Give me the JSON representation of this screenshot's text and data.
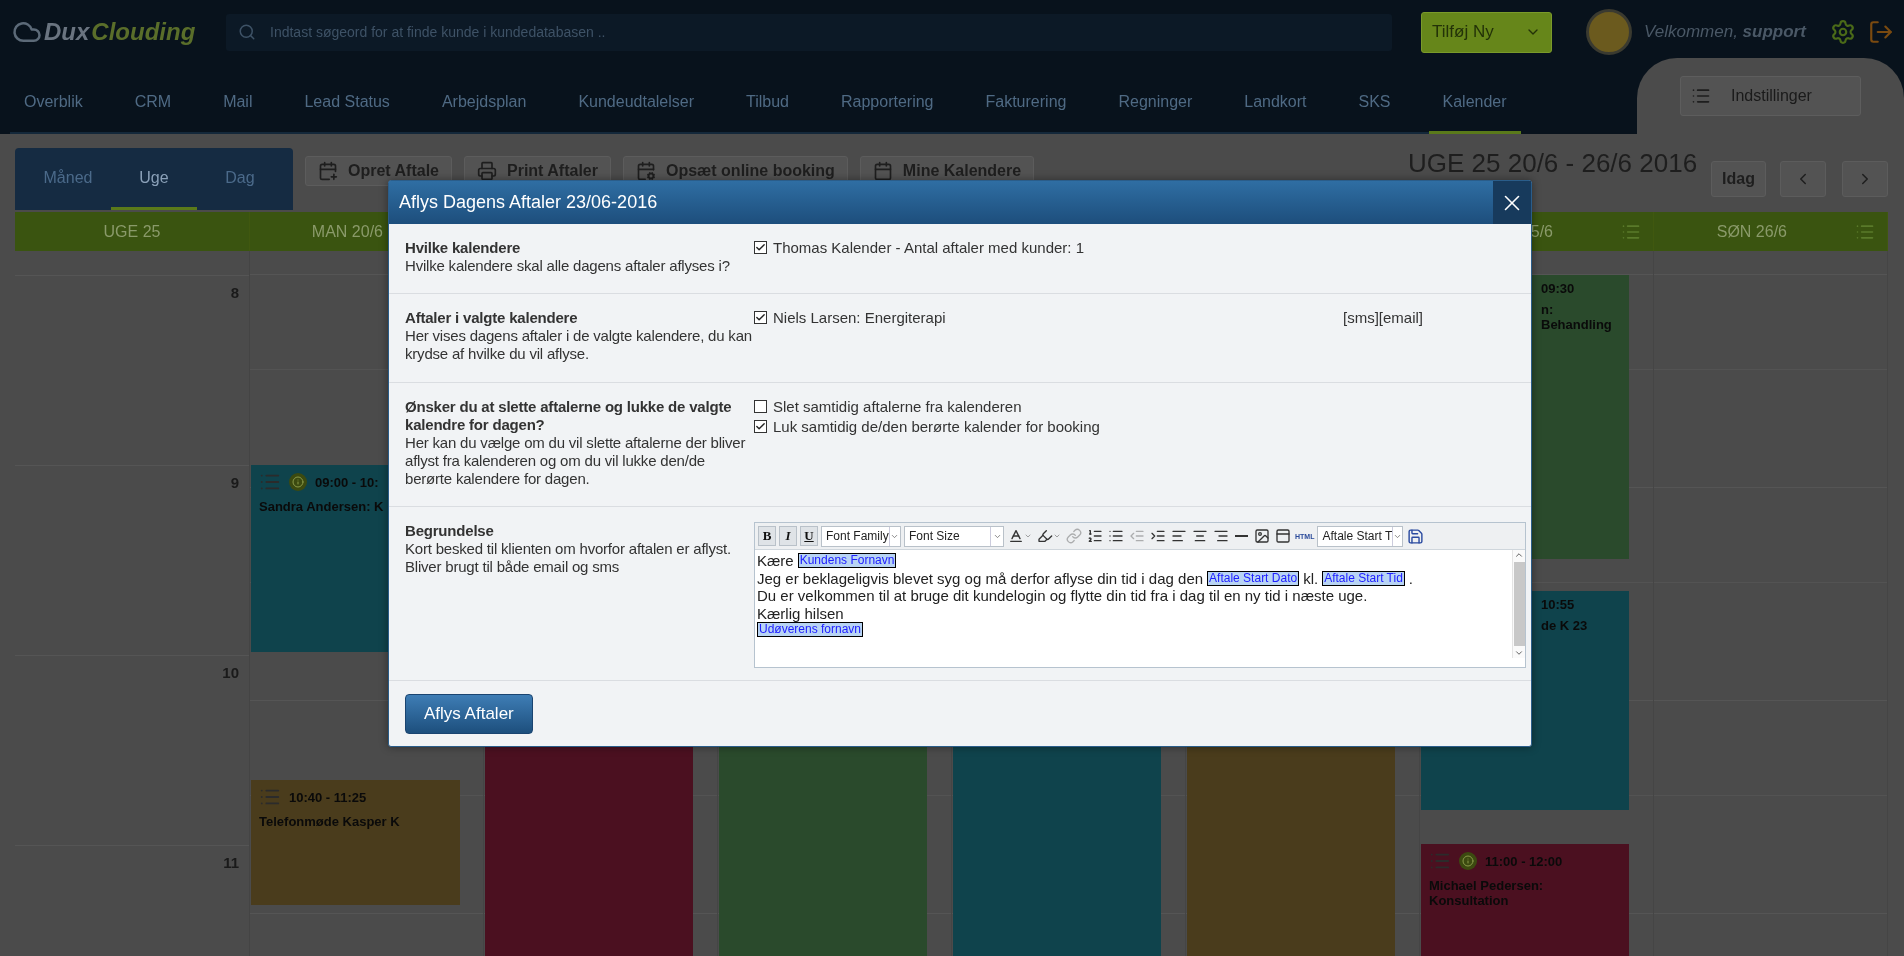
{
  "header": {
    "logo": {
      "part_1": "Dux",
      "part_2": "Clouding"
    },
    "search": {
      "placeholder": "Indtast søgeord for at finde kunde i kundedatabasen .."
    },
    "add_button": "Tilføj Ny",
    "welcome": "Velkommen, **support**"
  },
  "nav": {
    "items": [
      {
        "label": "Overblik",
        "selected": false
      },
      {
        "label": "CRM",
        "selected": false
      },
      {
        "label": "Mail",
        "selected": false
      },
      {
        "label": "Lead Status",
        "selected": false
      },
      {
        "label": "Arbejdsplan",
        "selected": false
      },
      {
        "label": "Kundeudtalelser",
        "selected": false
      },
      {
        "label": "Tilbud",
        "selected": false
      },
      {
        "label": "Rapportering",
        "selected": false
      },
      {
        "label": "Fakturering",
        "selected": false
      },
      {
        "label": "Regninger",
        "selected": false
      },
      {
        "label": "Landkort",
        "selected": false
      },
      {
        "label": "SKS",
        "selected": false
      },
      {
        "label": "Kalender",
        "selected": true
      }
    ],
    "settings_button": "Indstillinger"
  },
  "calendar": {
    "views": [
      {
        "label": "Måned",
        "selected": false
      },
      {
        "label": "Uge",
        "selected": true
      },
      {
        "label": "Dag",
        "selected": false
      }
    ],
    "actions": [
      "Opret Aftale",
      "Print Aftaler",
      "Opsæt online booking",
      "Mine Kalendere"
    ],
    "week_title": "UGE 25 20/6 - 26/6 2016",
    "today_button": "Idag",
    "day_headers": [
      "UGE 25",
      "MAN 20/6",
      "5/6",
      "SØN 26/6"
    ],
    "hours": [
      "8",
      "9",
      "10",
      "11"
    ],
    "events": [
      {
        "time": "09:00 - 10:",
        "title": "Sandra Andersen: K",
        "color": "#0f434c",
        "info": true
      },
      {
        "time": "10:40 - 11:25",
        "title": "Telefonmøde Kasper K",
        "color": "#4a3c1c",
        "info": false
      },
      {
        "color": "#4b1020"
      },
      {
        "color": "#2a4a2c"
      },
      {
        "color": "#0f434c"
      },
      {
        "color": "#4a3c1c"
      },
      {
        "time": "09:30",
        "title": "n: Behandling",
        "color": "#2a4a2c",
        "info": false
      },
      {
        "time": "10:55",
        "title": "de K 23",
        "color": "#0f434c",
        "info": false
      },
      {
        "time": "11:00 - 12:00",
        "title": "Michael Pedersen: Konsultation",
        "color": "#4b1020",
        "info": true
      }
    ]
  },
  "modal": {
    "title": "Aflys Dagens Aftaler 23/06-2016",
    "sections": [
      {
        "kind": "checks",
        "label": "Hvilke kalendere",
        "description": "Hvilke kalendere skal alle dagens aftaler aflyses i?",
        "options": [
          {
            "label": "Thomas Kalender - Antal aftaler med kunder: 1",
            "checked": true
          }
        ]
      },
      {
        "kind": "checks",
        "label": "Aftaler i valgte kalendere",
        "description": "Her vises dagens aftaler i de valgte kalendere, du kan krydse af hvilke du vil aflyse.",
        "options": [
          {
            "label": "Niels Larsen: Energiterapi",
            "checked": true,
            "note": "[sms][email]"
          }
        ]
      },
      {
        "kind": "checks",
        "label": "Ønsker du at slette aftalerne og lukke de valgte kalendre for dagen?",
        "description": "Her kan du vælge om du vil slette aftalerne der bliver aflyst fra kalenderen og om du vil lukke den/de berørte kalendere for dagen.",
        "options": [
          {
            "label": "Slet samtidig aftalerne fra kalenderen",
            "checked": false
          },
          {
            "label": "Luk samtidig de/den berørte kalender for booking",
            "checked": true
          }
        ]
      },
      {
        "kind": "editor",
        "label": "Begrundelse",
        "description": "Kort besked til klienten om hvorfor aftalen er aflyst. Bliver brugt til både email og sms",
        "editor": {
          "format_buttons": [
            "B",
            "I",
            "U"
          ],
          "font_family": "Font Family",
          "font_size": "Font Size",
          "tools": [
            {
              "disabled": false
            },
            {
              "disabled": false
            },
            {
              "disabled": true
            },
            {
              "disabled": false
            },
            {
              "disabled": false
            },
            {
              "disabled": true
            },
            {
              "disabled": false
            },
            {
              "disabled": false
            },
            {
              "disabled": false
            },
            {
              "disabled": false
            },
            {
              "disabled": false
            },
            {
              "disabled": false
            },
            {
              "disabled": false
            }
          ],
          "html_button": "HTML",
          "field_select": "Aftale Start T",
          "lines": [
            [
              {
                "kind": "text",
                "text": "Kære"
              },
              {
                "kind": "field",
                "text": "Kundens Fornavn"
              }
            ],
            [
              {
                "kind": "text",
                "text": "Jeg er beklageligvis blevet syg og må derfor aflyse din tid i dag den"
              },
              {
                "kind": "field",
                "text": "Aftale Start Dato"
              },
              {
                "kind": "text",
                "text": "kl."
              },
              {
                "kind": "field",
                "text": "Aftale Start Tid"
              },
              {
                "kind": "text",
                "text": "."
              }
            ],
            [
              {
                "kind": "text",
                "text": "Du er velkommen til at bruge dit kundelogin og flytte din tid fra i dag til en ny tid i næste uge."
              }
            ],
            [
              {
                "kind": "text",
                "text": "Kærlig hilsen"
              }
            ],
            [
              {
                "kind": "field",
                "text": "Udøverens fornavn"
              }
            ]
          ]
        }
      }
    ],
    "submit": "Aflys Aftaler"
  }
}
